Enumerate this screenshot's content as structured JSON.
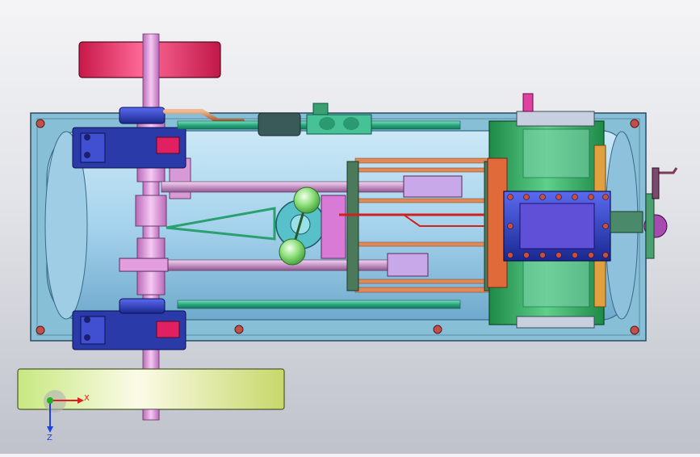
{
  "viewport": {
    "name": "cad-3d-viewport",
    "model": "steam-engine-assembly",
    "background_top": "#f4f4f6",
    "background_bottom": "#bfc2cb"
  },
  "triad": {
    "x_label": "X",
    "z_label": "Z",
    "x_color": "#e02020",
    "y_color": "#20b020",
    "z_color": "#2040e0"
  },
  "colors": {
    "base_plate": "#8fc4dc",
    "boiler": "#a9d6ee",
    "flywheel_top": "#e0205a",
    "flywheel_bottom": "#d8ec9a",
    "crankshaft": "#e39ee0",
    "bearing": "#3040c0",
    "cylinder_block": "#2f9e58",
    "cylinder_cover": "#6a4ae0",
    "steam_pipe": "#3bb08a",
    "copper_pipe": "#c87a4a",
    "flyball": "#9ee89a",
    "bolt": "#c0504a"
  }
}
